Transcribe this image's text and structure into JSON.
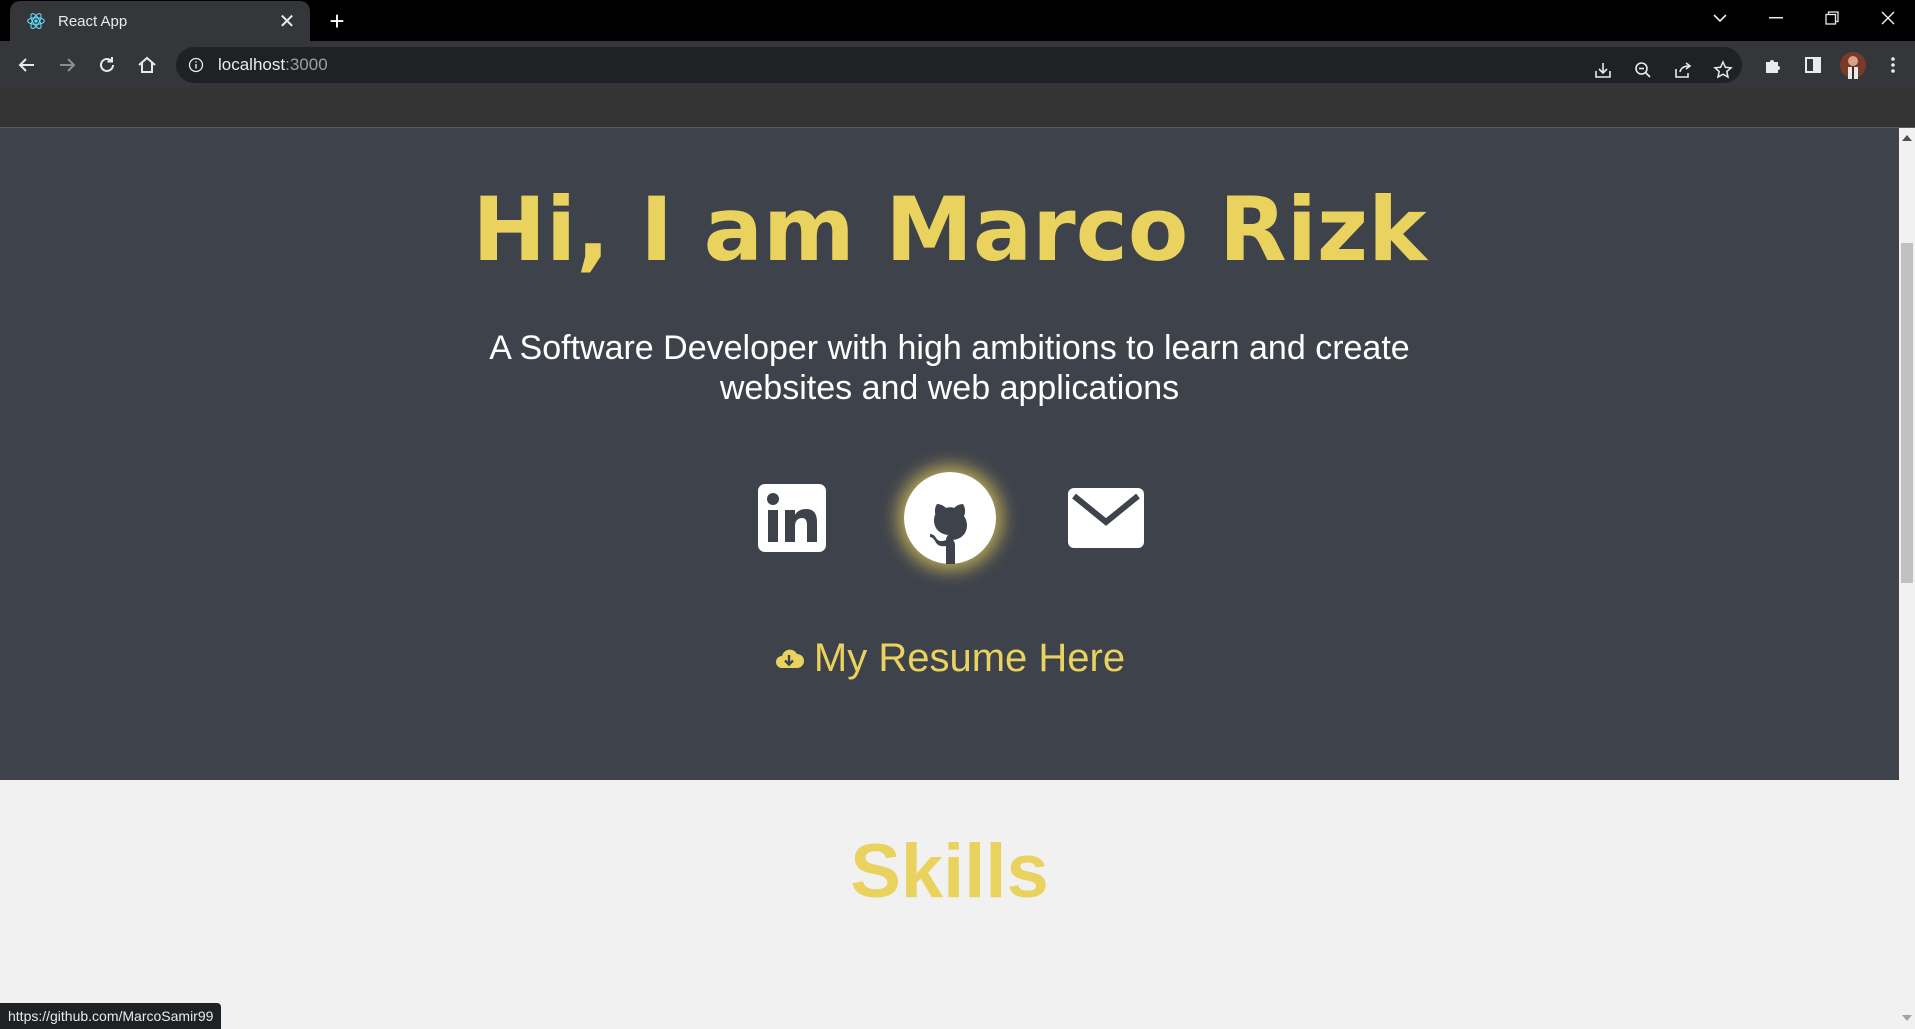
{
  "browser": {
    "tab_title": "React App",
    "url_host": "localhost",
    "url_port": ":3000",
    "status_url": "https://github.com/MarcoSamir99"
  },
  "hero": {
    "title": "Hi, I am Marco Rizk",
    "subtitle": "A Software Developer with high ambitions to learn and create websites and web applications",
    "resume_label": "My Resume Here",
    "accent_color": "#ead25e",
    "background_color": "#3e424b"
  },
  "social": [
    "linkedin-icon",
    "github-icon",
    "mail-icon"
  ],
  "skills": {
    "heading": "Skills"
  }
}
